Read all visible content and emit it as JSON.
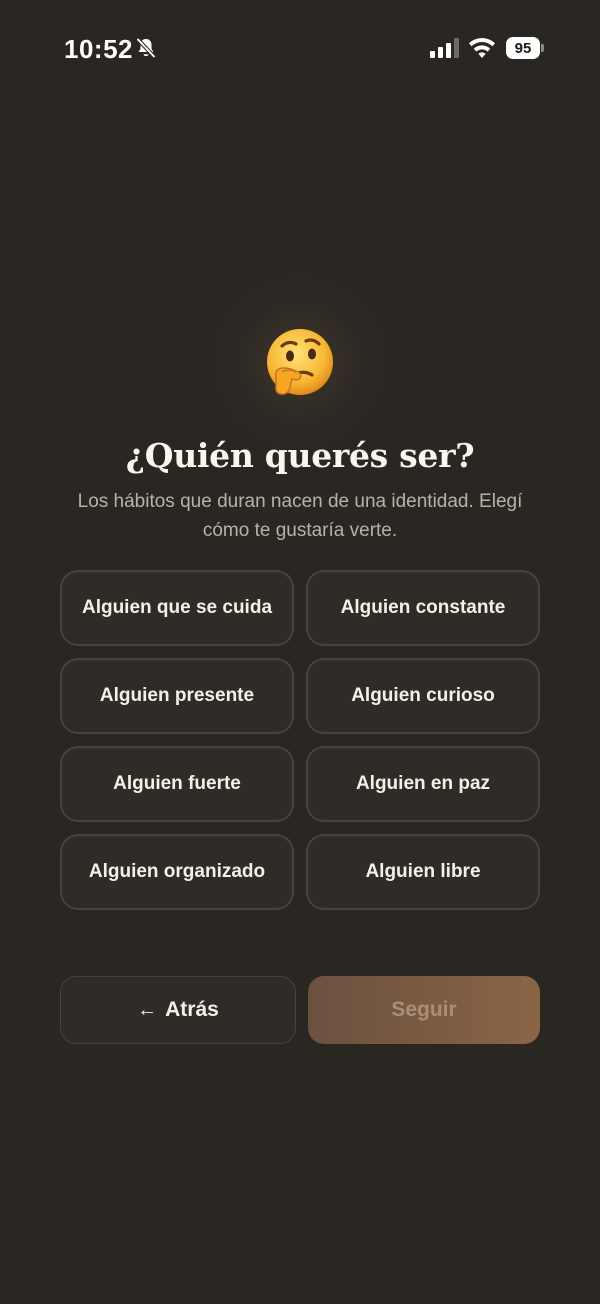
{
  "status_bar": {
    "time": "10:52",
    "battery": "95"
  },
  "header": {
    "emoji": "thinking-face",
    "title": "¿Quién querés ser?",
    "subtitle": "Los hábitos que duran nacen de una identidad. Elegí cómo te gustaría verte."
  },
  "options": [
    {
      "label": "Alguien que se cuida"
    },
    {
      "label": "Alguien constante"
    },
    {
      "label": "Alguien presente"
    },
    {
      "label": "Alguien curioso"
    },
    {
      "label": "Alguien fuerte"
    },
    {
      "label": "Alguien en paz"
    },
    {
      "label": "Alguien organizado"
    },
    {
      "label": "Alguien libre"
    }
  ],
  "actions": {
    "back_arrow": "←",
    "back_label": "Atrás",
    "next_label": "Seguir"
  },
  "colors": {
    "background": "#2a2723",
    "accent": "#8a6445",
    "card": "#2f2c28"
  }
}
